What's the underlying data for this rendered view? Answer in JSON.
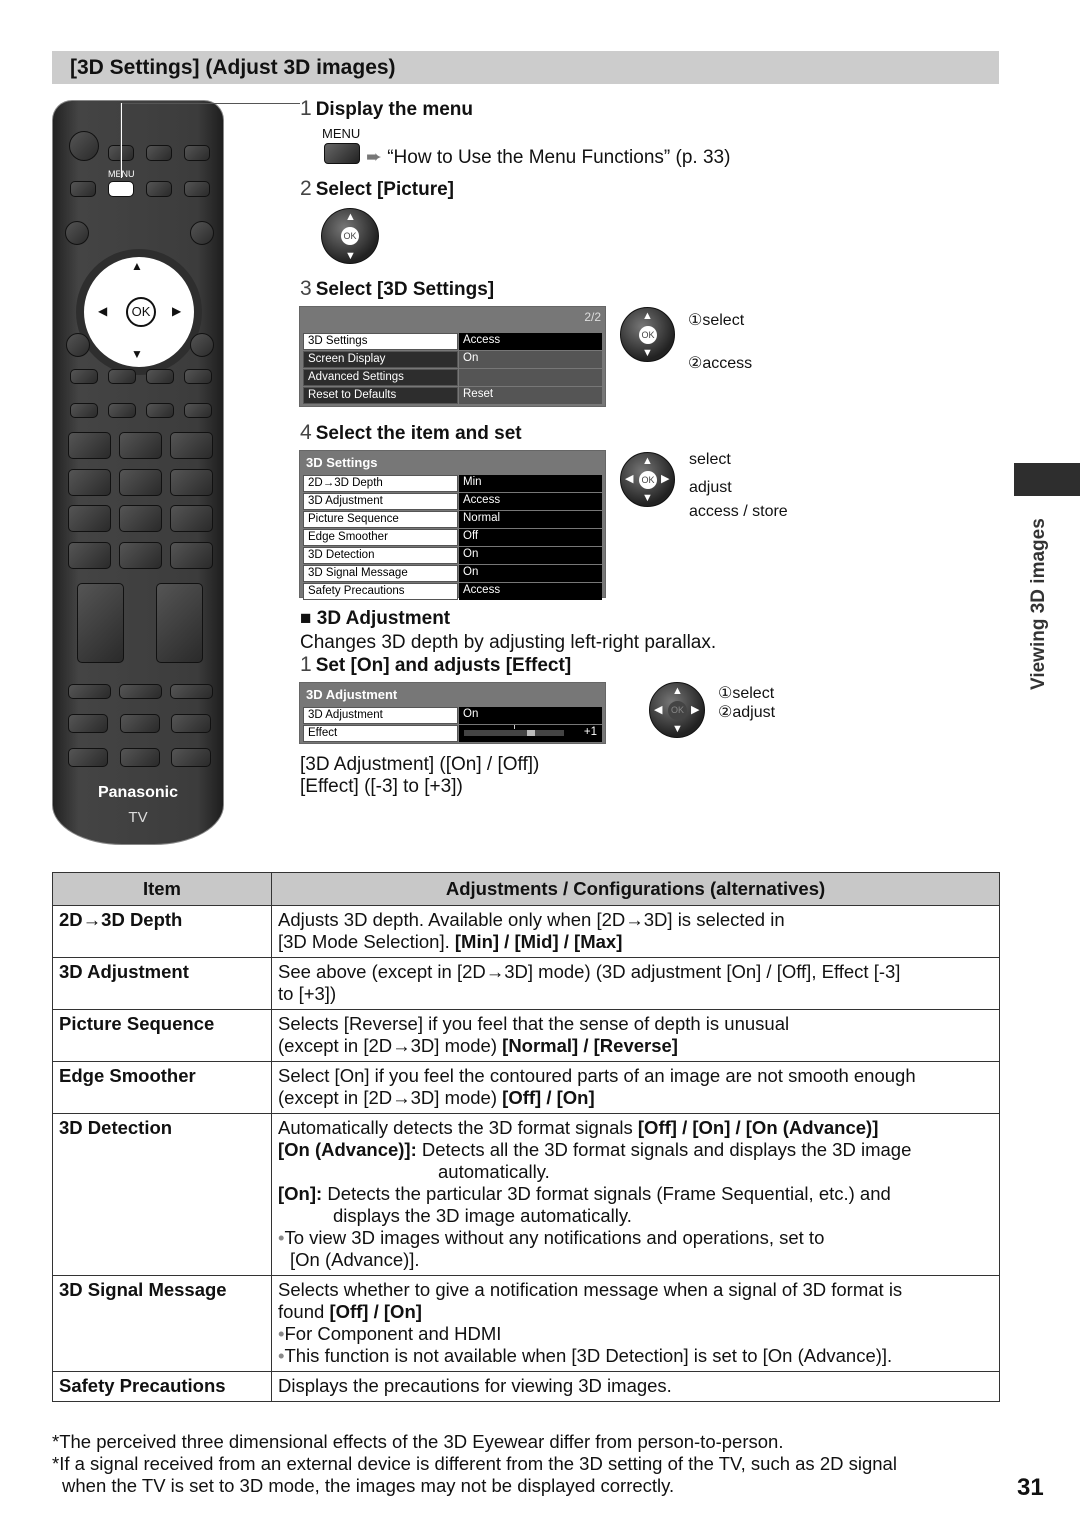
{
  "header": {
    "title": "[3D Settings] (Adjust 3D images)"
  },
  "remote": {
    "menu_label": "MENU",
    "ok_label": "OK",
    "brand": "Panasonic",
    "model": "TV"
  },
  "steps": {
    "step1": {
      "num": "1",
      "label": "Display the menu",
      "button_label": "MENU",
      "reference": "“How to Use the Menu Functions” (p. 33)"
    },
    "step2": {
      "num": "2",
      "label": "Select [Picture]"
    },
    "step3": {
      "num": "3",
      "label": "Select [3D Settings]"
    },
    "step4": {
      "num": "4",
      "label": "Select the item and set"
    }
  },
  "picture_menu": {
    "page": "2/2",
    "rows": [
      {
        "key": "3D Settings",
        "value": "Access"
      },
      {
        "key": "Screen Display",
        "value": "On"
      },
      {
        "key": "Advanced Settings",
        "value": ""
      },
      {
        "key": "Reset to Defaults",
        "value": "Reset"
      }
    ]
  },
  "nav_hints_1": {
    "ok": "OK",
    "select": "①select",
    "access": "②access"
  },
  "settings_menu": {
    "title": "3D Settings",
    "rows": [
      {
        "key": "2D→3D Depth",
        "value": "Min"
      },
      {
        "key": "3D Adjustment",
        "value": "Access"
      },
      {
        "key": "Picture Sequence",
        "value": "Normal"
      },
      {
        "key": "Edge Smoother",
        "value": "Off"
      },
      {
        "key": "3D Detection",
        "value": "On"
      },
      {
        "key": "3D Signal Message",
        "value": "On"
      },
      {
        "key": "Safety Precautions",
        "value": "Access"
      }
    ]
  },
  "nav_hints_2": {
    "ok": "OK",
    "select": "select",
    "adjust": "adjust",
    "access_store": "access / store"
  },
  "adjustment_section": {
    "heading": "3D Adjustment",
    "description": "Changes 3D depth by adjusting left-right parallax.",
    "step_num": "1",
    "step_label": "Set [On] and adjusts [Effect]",
    "menu_title": "3D Adjustment",
    "rows": [
      {
        "key": "3D Adjustment",
        "value": "On"
      },
      {
        "key": "Effect",
        "value": "+1"
      }
    ],
    "effect_value": 1,
    "effect_range": [
      -3,
      3
    ],
    "nav_ok": "OK",
    "nav_select": "①select",
    "nav_adjust": "②adjust",
    "note1": "[3D Adjustment] ([On] / [Off])",
    "note2": "[Effect] ([-3] to [+3])"
  },
  "side": {
    "label": "Viewing 3D images"
  },
  "table": {
    "headers": [
      "Item",
      "Adjustments / Configurations (alternatives)"
    ],
    "rows": [
      {
        "item": "2D→3D Depth",
        "l1": "Adjusts 3D depth. Available only when [2D→3D] is selected in",
        "l2": "[3D Mode Selection]. ",
        "l2b": "[Min] / [Mid] / [Max]"
      },
      {
        "item": "3D Adjustment",
        "l1": "See above (except in [2D→3D] mode) (3D adjustment [On] / [Off], Effect [-3]",
        "l2": "to [+3])"
      },
      {
        "item": "Picture Sequence",
        "l1": "Selects [Reverse] if you feel that the sense of depth is unusual",
        "l2": "(except in [2D→3D] mode) ",
        "l2b": "[Normal] / [Reverse]"
      },
      {
        "item": "Edge Smoother",
        "l1": "Select [On] if you feel the contoured parts of an image are not smooth enough",
        "l2": "(except in [2D→3D] mode) ",
        "l2b": "[Off] / [On]"
      },
      {
        "item": "3D Detection",
        "l1": "Automatically detects the 3D format signals ",
        "l1b": "[Off] / [On] / [On (Advance)]",
        "adv_b": "[On (Advance)]:",
        "adv": " Detects all the 3D format signals and displays the 3D image",
        "adv2": "automatically.",
        "on_b": "[On]:",
        "on": " Detects the particular 3D format signals (Frame Sequential, etc.) and",
        "on2": "displays the 3D image automatically.",
        "bullet": "To view 3D images without any notifications and operations, set to",
        "bullet2": "[On (Advance)]."
      },
      {
        "item": "3D Signal Message",
        "l1": "Selects whether to give a notification message when a signal of 3D format is",
        "l2": "found ",
        "l2b": "[Off] / [On]",
        "b1": "For Component and HDMI",
        "b2": "This function is not available when [3D Detection] is set to [On (Advance)]."
      },
      {
        "item": "Safety Precautions",
        "l1": "Displays the precautions for viewing 3D images."
      }
    ]
  },
  "footnotes": [
    "*The perceived three dimensional effects of the 3D Eyewear differ from person-to-person.",
    "*If a signal received from an external device is different from the 3D setting of the TV, such as 2D signal",
    "when the TV is set to 3D mode, the images may not be displayed correctly."
  ],
  "page_number": "31"
}
